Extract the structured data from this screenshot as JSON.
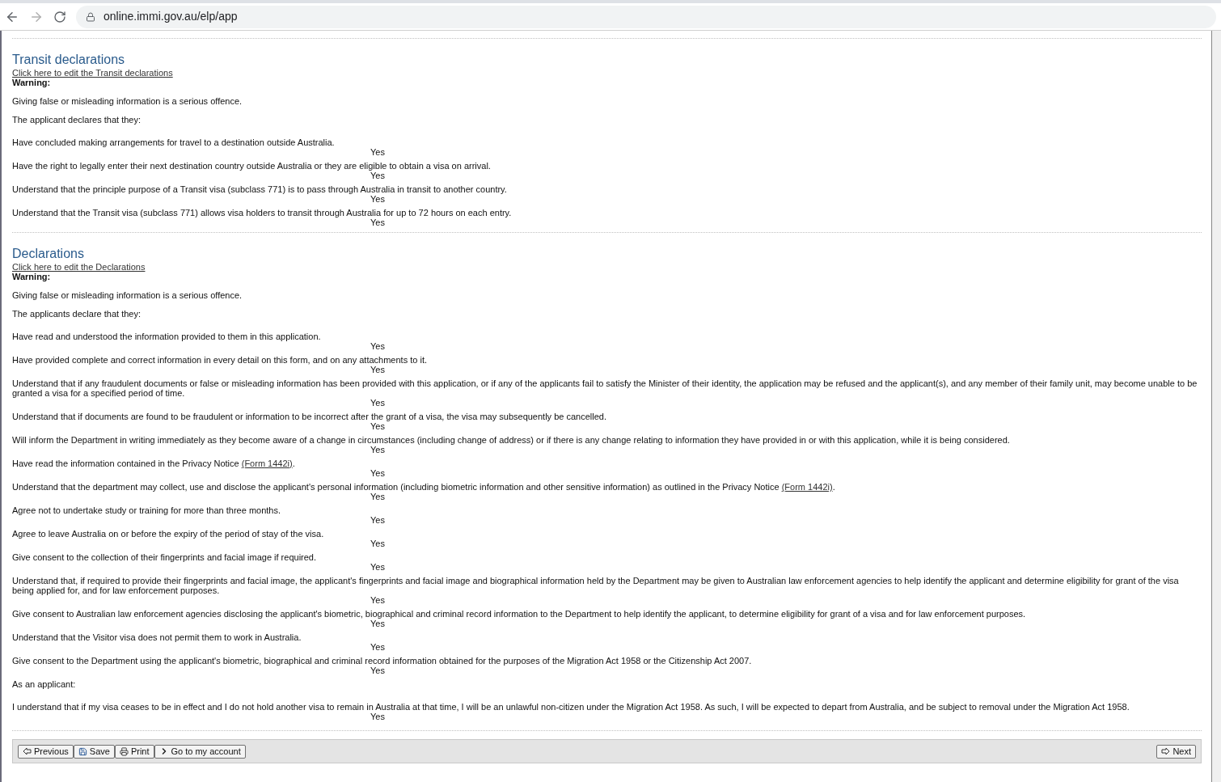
{
  "browser": {
    "url": "online.immi.gov.au/elp/app"
  },
  "sections": [
    {
      "title": "Transit declarations",
      "edit_link": "Click here to edit the Transit declarations",
      "warning_label": "Warning:",
      "warning_text": "Giving false or misleading information is a serious offence.",
      "intro": "The applicant declares that they:",
      "items": [
        {
          "kind": "statement",
          "text": "Have concluded making arrangements for travel to a destination outside Australia.",
          "answer": "Yes"
        },
        {
          "kind": "statement",
          "text": "Have the right to legally enter their next destination country outside Australia or they are eligible to obtain a visa on arrival.",
          "answer": "Yes"
        },
        {
          "kind": "statement",
          "text": "Understand that the principle purpose of a Transit visa (subclass 771) is to pass through Australia in transit to another country.",
          "answer": "Yes"
        },
        {
          "kind": "statement",
          "text": "Understand that the Transit visa (subclass 771) allows visa holders to transit through Australia for up to 72 hours on each entry.",
          "answer": "Yes"
        }
      ]
    },
    {
      "title": "Declarations",
      "edit_link": "Click here to edit the Declarations",
      "warning_label": "Warning:",
      "warning_text": "Giving false or misleading information is a serious offence.",
      "intro": "The applicants declare that they:",
      "items": [
        {
          "kind": "statement",
          "text": "Have read and understood the information provided to them in this application.",
          "answer": "Yes"
        },
        {
          "kind": "statement",
          "text": "Have provided complete and correct information in every detail on this form, and on any attachments to it.",
          "answer": "Yes"
        },
        {
          "kind": "statement",
          "text": "Understand that if any fraudulent documents or false or misleading information has been provided with this application, or if any of the applicants fail to satisfy the Minister of their identity, the application may be refused and the applicant(s), and any member of their family unit, may become unable to be granted a visa for a specified period of time.",
          "answer": "Yes"
        },
        {
          "kind": "statement",
          "text": "Understand that if documents are found to be fraudulent or information to be incorrect after the grant of a visa, the visa may subsequently be cancelled.",
          "answer": "Yes"
        },
        {
          "kind": "statement",
          "text": "Will inform the Department in writing immediately as they become aware of a change in circumstances (including change of address) or if there is any change relating to information they have provided in or with this application, while it is being considered.",
          "answer": "Yes"
        },
        {
          "kind": "statement",
          "text": "Have read the information contained in the Privacy Notice ",
          "link": "(Form 1442i)",
          "after": ".",
          "answer": "Yes"
        },
        {
          "kind": "statement",
          "text": "Understand that the department may collect, use and disclose the applicant's personal information (including biometric information and other sensitive information) as outlined in the Privacy Notice ",
          "link": "(Form 1442i)",
          "after": ".",
          "answer": "Yes"
        },
        {
          "kind": "statement",
          "text": "Agree not to undertake study or training for more than three months.",
          "answer": "Yes"
        },
        {
          "kind": "statement",
          "text": "Agree to leave Australia on or before the expiry of the period of stay of the visa.",
          "answer": "Yes"
        },
        {
          "kind": "statement",
          "text": "Give consent to the collection of their fingerprints and facial image if required.",
          "answer": "Yes"
        },
        {
          "kind": "statement",
          "text": "Understand that, if required to provide their fingerprints and facial image, the applicant's fingerprints and facial image and biographical information held by the Department may be given to Australian law enforcement agencies to help identify the applicant and determine eligibility for grant of the visa being applied for, and for law enforcement purposes.",
          "answer": "Yes"
        },
        {
          "kind": "statement",
          "text": "Give consent to Australian law enforcement agencies disclosing the applicant's biometric, biographical and criminal record information to the Department to help identify the applicant, to determine eligibility for grant of a visa and for law enforcement purposes.",
          "answer": "Yes"
        },
        {
          "kind": "statement",
          "text": "Understand that the Visitor visa does not permit them to work in Australia.",
          "answer": "Yes"
        },
        {
          "kind": "statement",
          "text": "Give consent to the Department using the applicant's biometric, biographical and criminal record information obtained for the purposes of the Migration Act 1958 or the Citizenship Act 2007.",
          "answer": "Yes"
        },
        {
          "kind": "note",
          "text": "As an applicant:"
        },
        {
          "kind": "statement",
          "text": "I understand that if my visa ceases to be in effect and I do not hold another visa to remain in Australia at that time, I will be an unlawful non-citizen under the Migration Act 1958. As such, I will be expected to depart from Australia, and be subject to removal under the Migration Act 1958.",
          "answer": "Yes"
        }
      ]
    }
  ],
  "toolbar": {
    "left": [
      {
        "kind": "previous",
        "label": "Previous"
      },
      {
        "kind": "save",
        "label": "Save"
      },
      {
        "kind": "print",
        "label": "Print"
      },
      {
        "kind": "account",
        "label": "Go to my account"
      }
    ],
    "right": [
      {
        "kind": "next",
        "label": "Next"
      }
    ]
  }
}
